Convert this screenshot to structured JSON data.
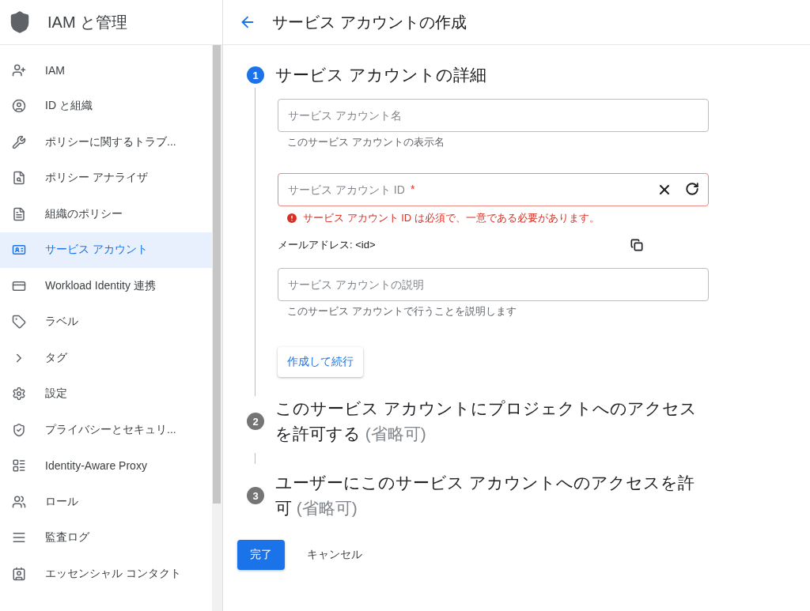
{
  "sidebar": {
    "title": "IAM と管理",
    "items": [
      {
        "label": "IAM",
        "selected": false
      },
      {
        "label": "ID と組織",
        "selected": false
      },
      {
        "label": "ポリシーに関するトラブ...",
        "selected": false
      },
      {
        "label": "ポリシー アナライザ",
        "selected": false
      },
      {
        "label": "組織のポリシー",
        "selected": false
      },
      {
        "label": "サービス アカウント",
        "selected": true
      },
      {
        "label": "Workload Identity 連携",
        "selected": false
      },
      {
        "label": "ラベル",
        "selected": false
      },
      {
        "label": "タグ",
        "selected": false
      },
      {
        "label": "設定",
        "selected": false
      },
      {
        "label": "プライバシーとセキュリ...",
        "selected": false
      },
      {
        "label": "Identity-Aware Proxy",
        "selected": false
      },
      {
        "label": "ロール",
        "selected": false
      },
      {
        "label": "監査ログ",
        "selected": false
      },
      {
        "label": "エッセンシャル コンタクト",
        "selected": false
      }
    ]
  },
  "header": {
    "title": "サービス アカウントの作成"
  },
  "steps": [
    {
      "number": "1",
      "title": "サービス アカウントの詳細",
      "active": true
    },
    {
      "number": "2",
      "title": "このサービス アカウントにプロジェクトへのアクセスを許可する",
      "note": "(省略可)",
      "active": false
    },
    {
      "number": "3",
      "title": "ユーザーにこのサービス アカウントへのアクセスを許可",
      "note": "(省略可)",
      "active": false
    }
  ],
  "fields": [
    {
      "placeholder": "サービス アカウント名",
      "hint": "このサービス アカウントの表示名",
      "error": false
    },
    {
      "placeholder": "サービス アカウント ID",
      "required_mark": "*",
      "error": true,
      "error_text": "サービス アカウント ID は必須で、一意である必要があります。"
    },
    {
      "placeholder": "サービス アカウントの説明",
      "hint": "このサービス アカウントで行うことを説明します",
      "error": false
    }
  ],
  "email": {
    "label": "メールアドレス: <id>"
  },
  "continue_button": "作成して続行",
  "done_button": "完了",
  "cancel_button": "キャンセル"
}
